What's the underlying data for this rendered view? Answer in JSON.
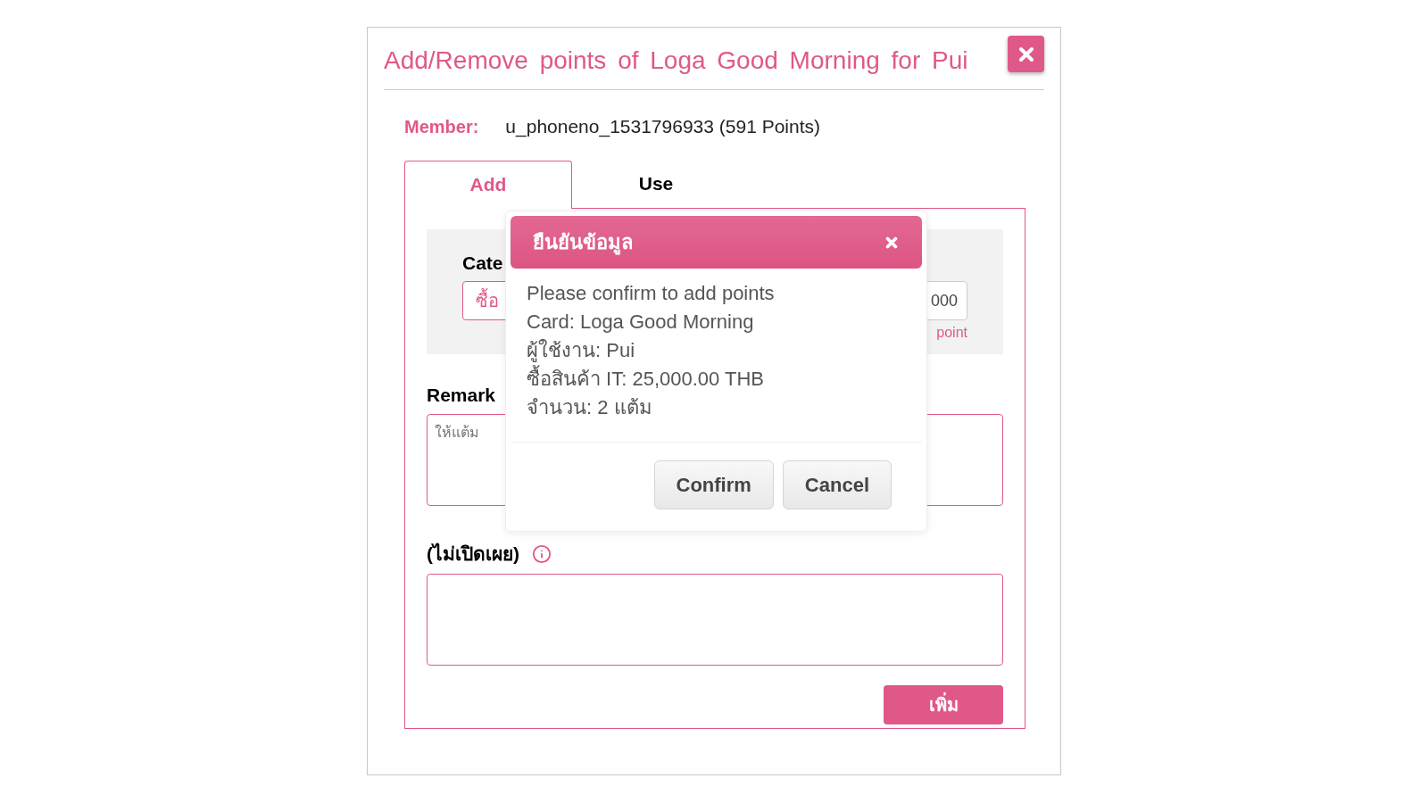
{
  "panel": {
    "title": "Add/Remove points of Loga Good Morning for Pui",
    "member_label": "Member:",
    "member_value": "u_phoneno_1531796933 (591 Points)"
  },
  "tabs": [
    {
      "label": "Add",
      "selected": true
    },
    {
      "label": "Use",
      "selected": false
    }
  ],
  "form": {
    "category_label": "Cate",
    "category_field": {
      "value": "ซื้อ"
    },
    "amount_field": {
      "value": "000"
    },
    "amount_unit": "point",
    "remark_label": "Remark",
    "remark_field": {
      "placeholder": "ให้แต้ม"
    },
    "private_label": "(ไม่เปิดเผย)",
    "submit": "เพิ่ม"
  },
  "dialog": {
    "title": "ยืนยันข้อมูล",
    "lines": [
      "Please confirm to add points",
      "Card: Loga Good Morning",
      "ผู้ใช้งาน: Pui",
      "ซื้อสินค้า IT: 25,000.00 THB",
      "จำนวน: 2 แต้ม"
    ],
    "buttons": [
      "Confirm",
      "Cancel"
    ]
  }
}
